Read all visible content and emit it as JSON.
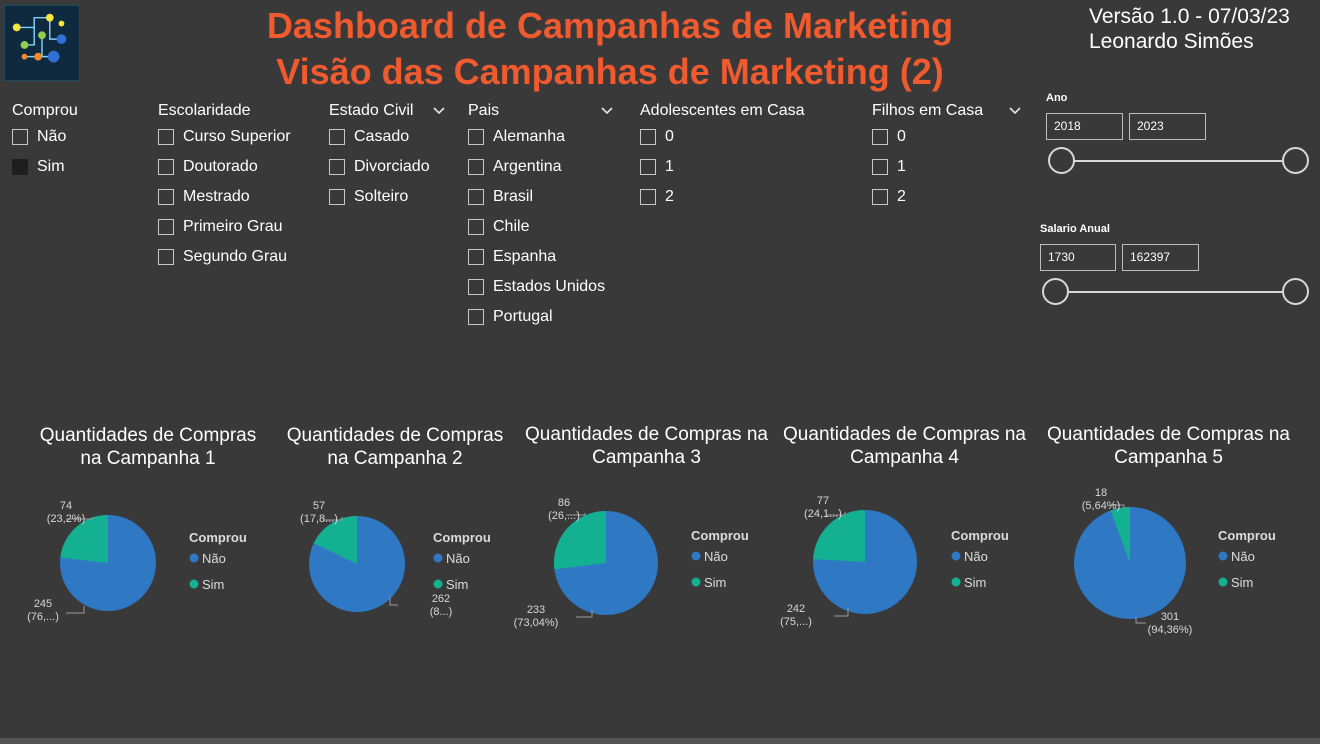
{
  "header": {
    "title_line1": "Dashboard de Campanhas de Marketing",
    "title_line2": "Visão das Campanhas de Marketing (2)",
    "version": "Versão 1.0 - 07/03/23",
    "author": "Leonardo Simões",
    "title_color": "#ef5a2f"
  },
  "slicers": {
    "comprou": {
      "label": "Comprou",
      "options": [
        "Não",
        "Sim"
      ]
    },
    "escolaridade": {
      "label": "Escolaridade",
      "options": [
        "Curso Superior",
        "Doutorado",
        "Mestrado",
        "Primeiro Grau",
        "Segundo Grau"
      ]
    },
    "estado_civil": {
      "label": "Estado Civil",
      "options": [
        "Casado",
        "Divorciado",
        "Solteiro"
      ]
    },
    "pais": {
      "label": "Pais",
      "options": [
        "Alemanha",
        "Argentina",
        "Brasil",
        "Chile",
        "Espanha",
        "Estados Unidos",
        "Portugal"
      ]
    },
    "adolescentes": {
      "label": "Adolescentes em Casa",
      "options": [
        "0",
        "1",
        "2"
      ]
    },
    "filhos": {
      "label": "Filhos em Casa",
      "options": [
        "0",
        "1",
        "2"
      ]
    }
  },
  "ranges": {
    "ano": {
      "label": "Ano",
      "min": "2018",
      "max": "2023"
    },
    "salario": {
      "label": "Salario Anual",
      "min": "1730",
      "max": "162397"
    }
  },
  "colors": {
    "nao": "#2f78c4",
    "sim": "#13b092",
    "label_line": "#9a9a9a"
  },
  "legend": {
    "title": "Comprou",
    "nao": "Não",
    "sim": "Sim"
  },
  "chart_data": [
    {
      "type": "pie",
      "title_line1": "Quantidades de Compras",
      "title_line2": "na Campanha 1",
      "slices": [
        {
          "name": "Sim",
          "value": 74,
          "label": "74",
          "pct_label": "(23,2%)"
        },
        {
          "name": "Não",
          "value": 245,
          "label": "245",
          "pct_label": "(76,...)"
        }
      ]
    },
    {
      "type": "pie",
      "title_line1": "Quantidades de Compras",
      "title_line2": "na Campanha 2",
      "slices": [
        {
          "name": "Sim",
          "value": 57,
          "label": "57",
          "pct_label": "(17,8...)"
        },
        {
          "name": "Não",
          "value": 262,
          "label": "262",
          "pct_label": "(8...)"
        }
      ]
    },
    {
      "type": "pie",
      "title_line1": "Quantidades de Compras na",
      "title_line2": "Campanha 3",
      "slices": [
        {
          "name": "Sim",
          "value": 86,
          "label": "86",
          "pct_label": "(26,...)"
        },
        {
          "name": "Não",
          "value": 233,
          "label": "233",
          "pct_label": "(73,04%)"
        }
      ]
    },
    {
      "type": "pie",
      "title_line1": "Quantidades de Compras na",
      "title_line2": "Campanha 4",
      "slices": [
        {
          "name": "Sim",
          "value": 77,
          "label": "77",
          "pct_label": "(24,1...)"
        },
        {
          "name": "Não",
          "value": 242,
          "label": "242",
          "pct_label": "(75,...)"
        }
      ]
    },
    {
      "type": "pie",
      "title_line1": "Quantidades de Compras na",
      "title_line2": "Campanha 5",
      "slices": [
        {
          "name": "Sim",
          "value": 18,
          "label": "18",
          "pct_label": "(5,64%)"
        },
        {
          "name": "Não",
          "value": 301,
          "label": "301",
          "pct_label": "(94,36%)"
        }
      ]
    }
  ]
}
